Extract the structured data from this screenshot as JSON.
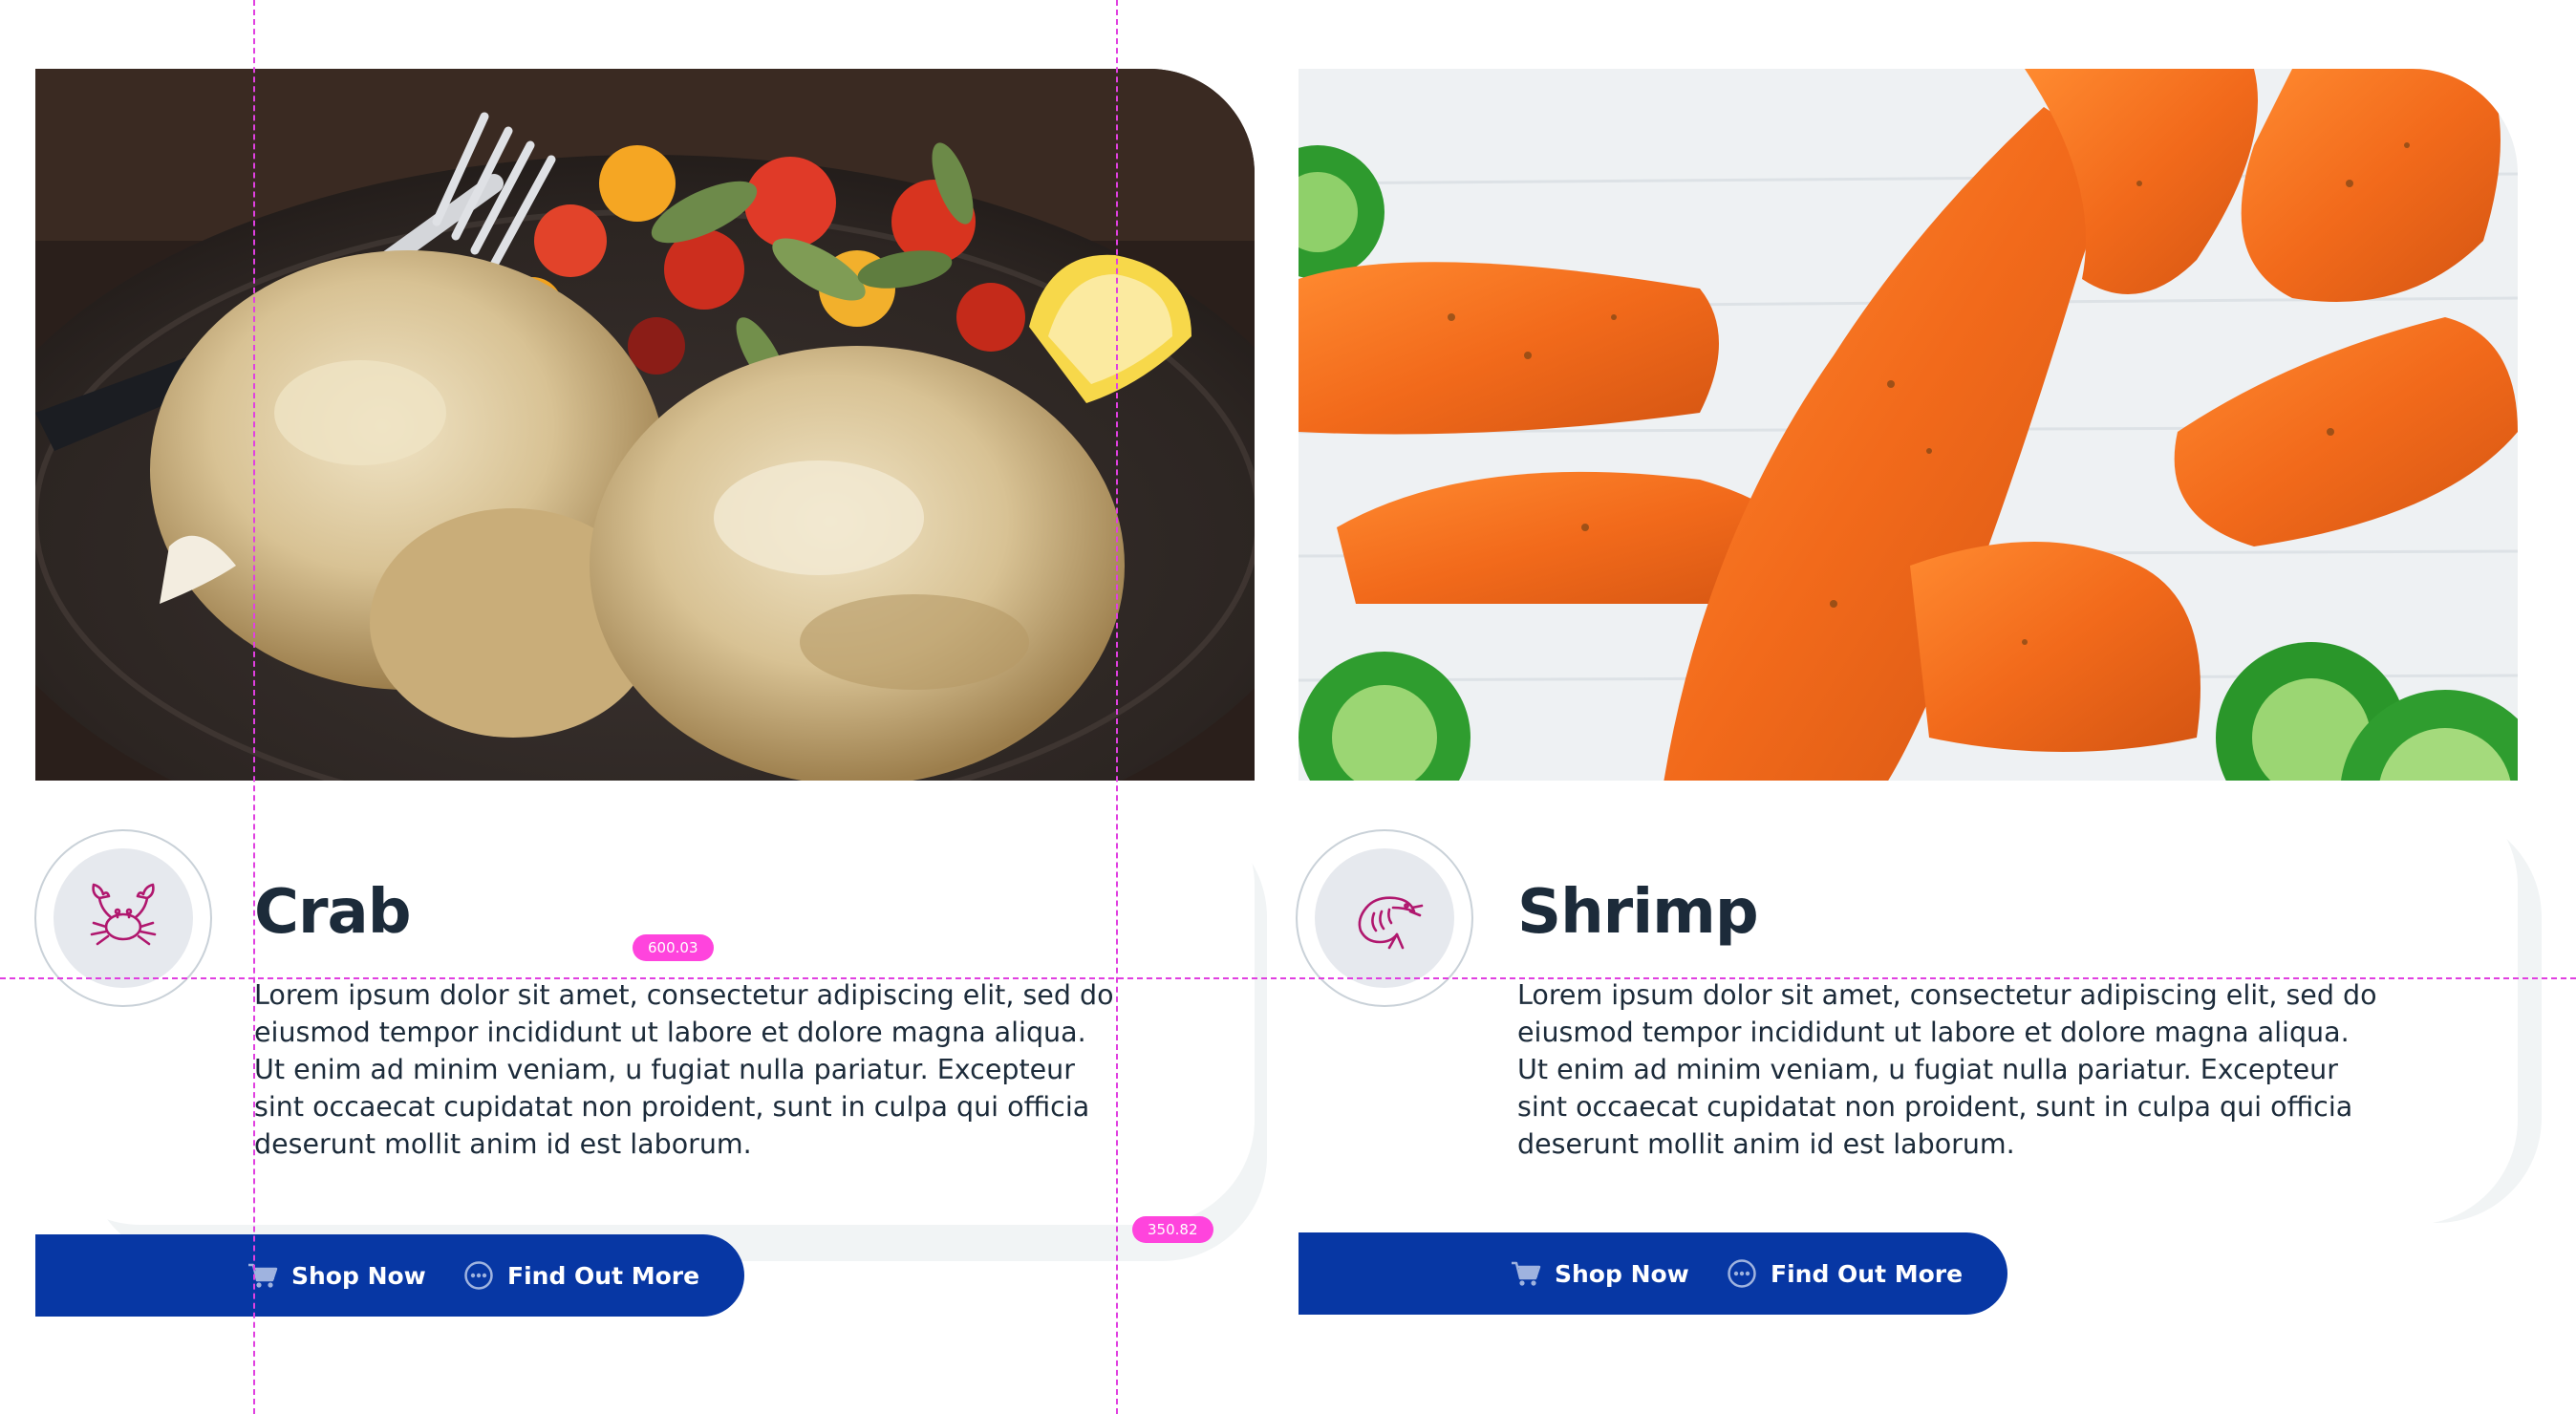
{
  "cards": [
    {
      "id": "crab",
      "title": "Crab",
      "icon": "crab-icon",
      "description": "Lorem ipsum dolor sit amet, consectetur adipiscing elit, sed do eiusmod tempor incididunt ut labore et dolore magna aliqua. Ut enim ad minim veniam, u fugiat nulla pariatur. Excepteur sint occaecat cupidatat non proident, sunt in culpa qui officia deserunt mollit anim id est laborum.",
      "shop_label": "Shop Now",
      "more_label": "Find Out More"
    },
    {
      "id": "shrimp",
      "title": "Shrimp",
      "icon": "shrimp-icon",
      "description": "Lorem ipsum dolor sit amet, consectetur adipiscing elit, sed do eiusmod tempor incididunt ut labore et dolore magna aliqua. Ut enim ad minim veniam, u fugiat nulla pariatur. Excepteur sint occaecat cupidatat non proident, sunt in culpa qui officia deserunt mollit anim id est laborum.",
      "shop_label": "Shop Now",
      "more_label": "Find Out More"
    }
  ],
  "measurements": {
    "height_label": "600.03",
    "width_label": "350.82"
  },
  "colors": {
    "cta_blue": "#0737a4",
    "title_navy": "#1c2b3a",
    "icon_magenta": "#b0176e",
    "guide_magenta": "#ff44dd"
  }
}
